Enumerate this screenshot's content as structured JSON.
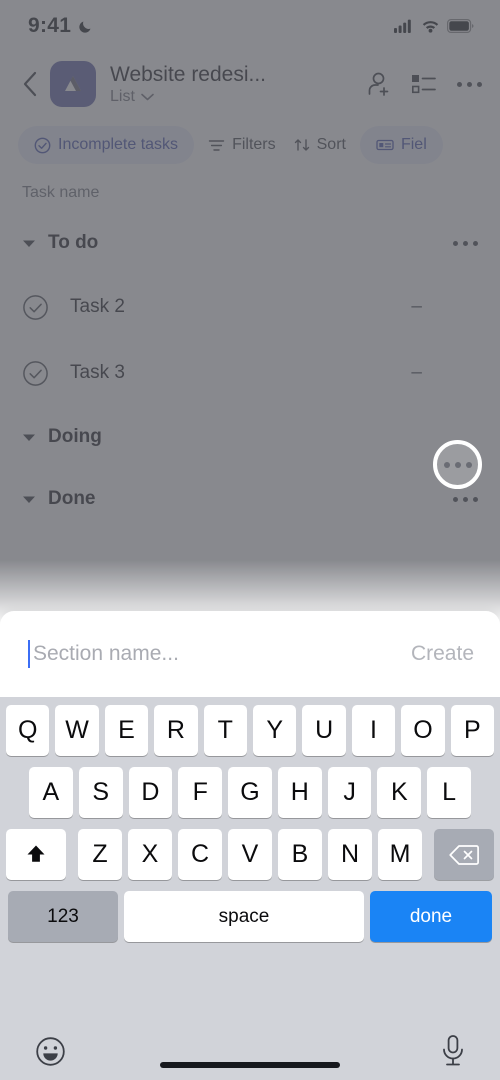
{
  "status_bar": {
    "time": "9:41",
    "dnd_icon": "moon-icon",
    "signal_icon": "cellular-signal-icon",
    "wifi_icon": "wifi-icon",
    "battery_icon": "battery-full-icon"
  },
  "header": {
    "back_icon": "chevron-left-icon",
    "project_avatar_icon": "project-logo-icon",
    "project_title": "Website redesi...",
    "view_label": "List",
    "view_chevron_icon": "chevron-down-icon",
    "add_member_icon": "add-person-icon",
    "task_view_icon": "list-view-icon",
    "overflow_icon": "more-horizontal-icon"
  },
  "chips": [
    {
      "label": "Incomplete tasks",
      "icon": "check-circle-icon",
      "style": "filled"
    },
    {
      "label": "Filters",
      "icon": "filter-icon",
      "style": "plain"
    },
    {
      "label": "Sort",
      "icon": "sort-icon",
      "style": "plain"
    },
    {
      "label": "Fiel",
      "icon": "fields-icon",
      "style": "filled"
    }
  ],
  "list": {
    "column_header": "Task name",
    "sections": [
      {
        "name": "To do",
        "disclosure_icon": "caret-down-icon",
        "menu_icon": "more-horizontal-icon",
        "tasks": [
          {
            "name": "Task 2",
            "check_icon": "check-circle-icon",
            "value": "–"
          },
          {
            "name": "Task 3",
            "check_icon": "check-circle-icon",
            "value": "–"
          }
        ]
      },
      {
        "name": "Doing",
        "disclosure_icon": "caret-down-icon",
        "menu_icon": "more-horizontal-icon",
        "tasks": []
      },
      {
        "name": "Done",
        "disclosure_icon": "caret-down-icon",
        "menu_icon": "more-horizontal-icon",
        "tasks": []
      }
    ]
  },
  "tap_highlight": {
    "target_icon": "more-horizontal-icon",
    "target_section": "Doing"
  },
  "sheet": {
    "input_value": "",
    "input_placeholder": "Section name...",
    "create_label": "Create",
    "caret_color": "#3b6ef5"
  },
  "keyboard": {
    "row1": [
      "Q",
      "W",
      "E",
      "R",
      "T",
      "Y",
      "U",
      "I",
      "O",
      "P"
    ],
    "row2": [
      "A",
      "S",
      "D",
      "F",
      "G",
      "H",
      "J",
      "K",
      "L"
    ],
    "row3": [
      "Z",
      "X",
      "C",
      "V",
      "B",
      "N",
      "M"
    ],
    "shift_icon": "shift-up-arrow-icon",
    "backspace_icon": "backspace-delete-icon",
    "numbers_label": "123",
    "space_label": "space",
    "done_label": "done",
    "done_color": "#1a84f5",
    "emoji_icon": "emoji-smiley-icon",
    "dictation_icon": "microphone-icon"
  },
  "home_indicator": "home-indicator"
}
